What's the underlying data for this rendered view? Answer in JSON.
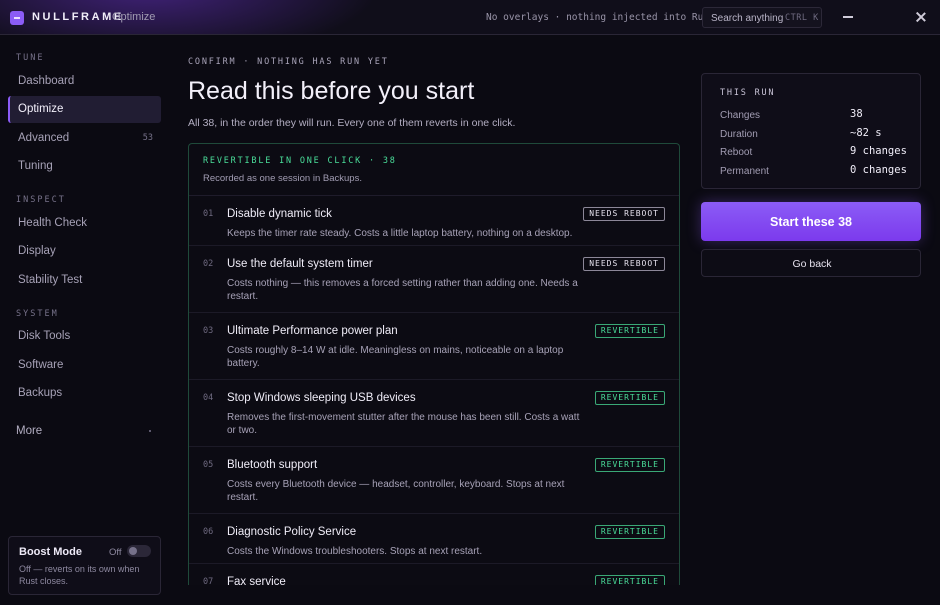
{
  "titlebar": {
    "brand": "NULLFRAME",
    "section": "Optimize",
    "status_note": "No overlays · nothing injected into Rust",
    "search_placeholder": "Search anything",
    "search_shortcut": "CTRL K"
  },
  "sidebar": {
    "groups": [
      {
        "label": "TUNE",
        "items": [
          {
            "label": "Dashboard"
          },
          {
            "label": "Optimize",
            "active": true
          },
          {
            "label": "Advanced",
            "badge": "53"
          },
          {
            "label": "Tuning"
          }
        ]
      },
      {
        "label": "INSPECT",
        "items": [
          {
            "label": "Health Check"
          },
          {
            "label": "Display"
          },
          {
            "label": "Stability Test"
          }
        ]
      },
      {
        "label": "SYSTEM",
        "items": [
          {
            "label": "Disk Tools"
          },
          {
            "label": "Software"
          },
          {
            "label": "Backups"
          }
        ]
      }
    ],
    "more": "More",
    "boost": {
      "title": "Boost Mode",
      "state": "Off",
      "description": "Off — reverts on its own when Rust closes."
    }
  },
  "main": {
    "crumb": "CONFIRM · NOTHING HAS RUN YET",
    "title": "Read this before you start",
    "lead": "All 38, in the order they will run. Every one of them reverts in one click.",
    "panel": {
      "kicker": "REVERTIBLE IN ONE CLICK · 38",
      "subtitle": "Recorded as one session in Backups.",
      "items": [
        {
          "num": "01",
          "title": "Disable dynamic tick",
          "desc": "Keeps the timer rate steady. Costs a little laptop battery, nothing on a desktop.",
          "tag": "NEEDS REBOOT"
        },
        {
          "num": "02",
          "title": "Use the default system timer",
          "desc": "Costs nothing — this removes a forced setting rather than adding one. Needs a restart.",
          "tag": "NEEDS REBOOT"
        },
        {
          "num": "03",
          "title": "Ultimate Performance power plan",
          "desc": "Costs roughly 8–14 W at idle. Meaningless on mains, noticeable on a laptop battery.",
          "tag": "REVERTIBLE"
        },
        {
          "num": "04",
          "title": "Stop Windows sleeping USB devices",
          "desc": "Removes the first-movement stutter after the mouse has been still. Costs a watt or two.",
          "tag": "REVERTIBLE"
        },
        {
          "num": "05",
          "title": "Bluetooth support",
          "desc": "Costs every Bluetooth device — headset, controller, keyboard. Stops at next restart.",
          "tag": "REVERTIBLE"
        },
        {
          "num": "06",
          "title": "Diagnostic Policy Service",
          "desc": "Costs the Windows troubleshooters. Stops at next restart.",
          "tag": "REVERTIBLE"
        },
        {
          "num": "07",
          "title": "Fax service",
          "desc": "",
          "tag": "REVERTIBLE"
        }
      ]
    }
  },
  "run": {
    "kicker": "THIS RUN",
    "rows": [
      {
        "label": "Changes",
        "value": "38"
      },
      {
        "label": "Duration",
        "value": "~82 s"
      },
      {
        "label": "Reboot",
        "value": "9 changes"
      },
      {
        "label": "Permanent",
        "value": "0 changes"
      }
    ],
    "start_label": "Start these 38",
    "back_label": "Go back"
  },
  "colors": {
    "accent": "#8b5cf6",
    "revertible": "#4ade9a",
    "background": "#0b0a12"
  }
}
